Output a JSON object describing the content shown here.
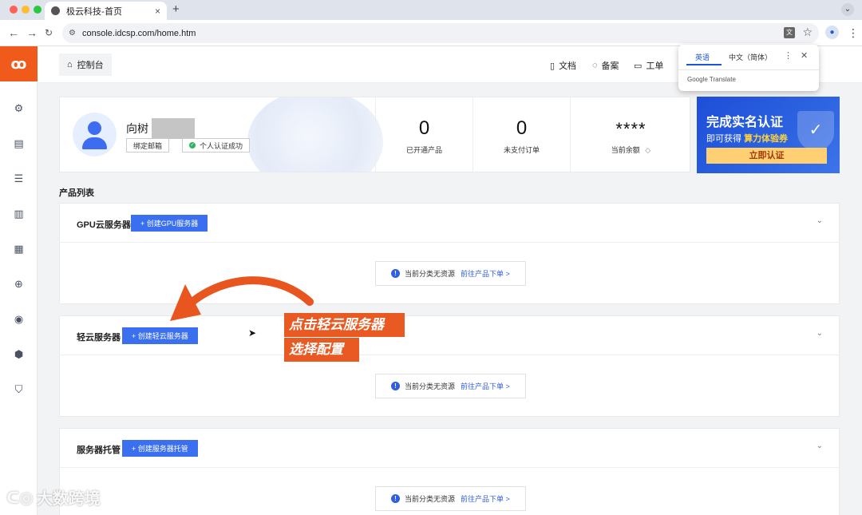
{
  "browser": {
    "tab_title": "极云科技-首页",
    "url": "console.idcsp.com/home.htm"
  },
  "translate_popup": {
    "tab_source": "英语",
    "tab_target": "中文（简体）",
    "brand": "Google Translate"
  },
  "topnav": {
    "crumb": "控制台",
    "links": [
      "文档",
      "备案",
      "工单"
    ]
  },
  "profile": {
    "name_prefix": "向树",
    "bind_email": "绑定邮箱",
    "verify_status": "个人认证成功",
    "stats": [
      {
        "value": "0",
        "label": "已开通产品"
      },
      {
        "value": "0",
        "label": "未支付订单"
      },
      {
        "value": "****",
        "label": "当前余额"
      }
    ]
  },
  "banner": {
    "title": "完成实名认证",
    "sub_prefix": "即可获得",
    "sub_highlight": "算力体验券",
    "button": "立即认证"
  },
  "product_list": {
    "title": "产品列表",
    "empty_text": "当前分类无资源",
    "empty_link": "前往产品下单 >",
    "sections": [
      {
        "name": "GPU云服务器",
        "button": "+ 创建GPU服务器"
      },
      {
        "name": "轻云服务器",
        "button": "+ 创建轻云服务器"
      },
      {
        "name": "服务器托管",
        "button": "+ 创建服务器托管"
      }
    ]
  },
  "annotation": {
    "line1": "点击轻云服务器",
    "line2": "选择配置"
  },
  "watermark": "大数跨境",
  "colors": {
    "brand": "#f05a1a",
    "primary": "#3a6ff0",
    "annotation": "#e85a22"
  }
}
